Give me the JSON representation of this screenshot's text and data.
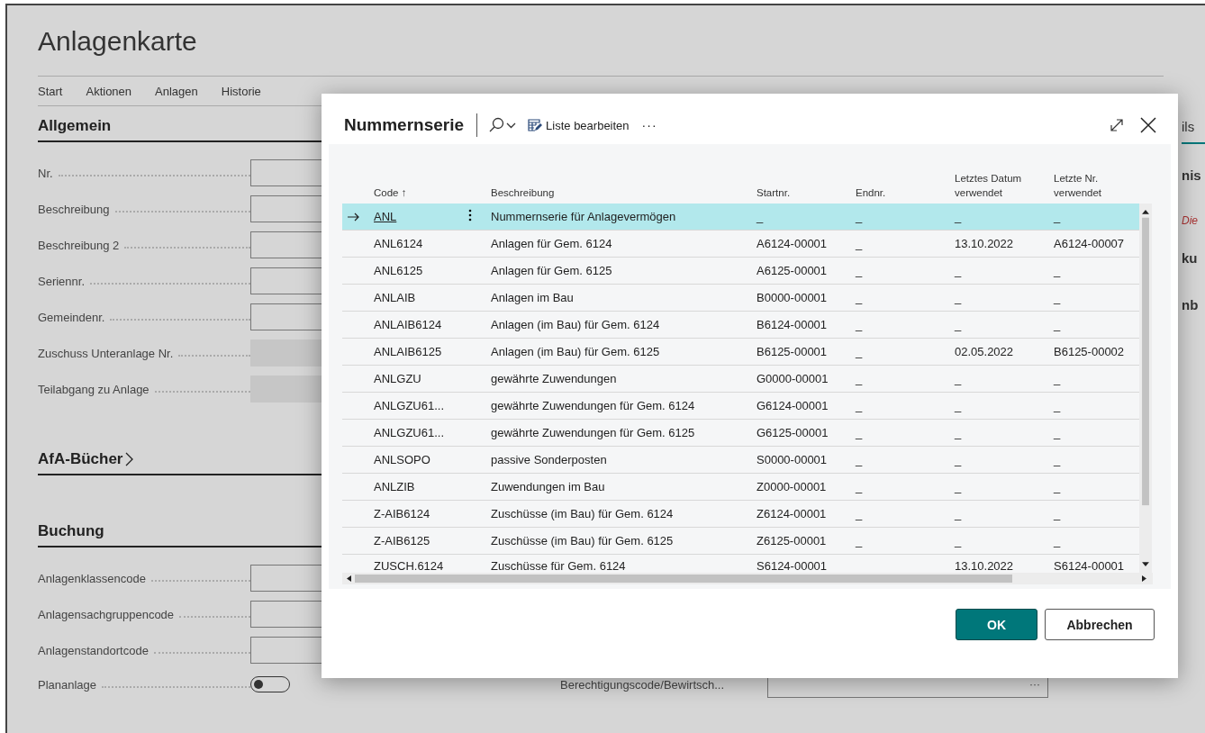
{
  "page": {
    "title": "Anlagenkarte",
    "tabs": [
      {
        "label": "Start"
      },
      {
        "label": "Aktionen"
      },
      {
        "label": "Anlagen"
      },
      {
        "label": "Historie"
      }
    ],
    "sections": [
      {
        "title": "Allgemein",
        "kind": "fields",
        "fields": [
          {
            "label": "Nr.",
            "disabled": false
          },
          {
            "label": "Beschreibung",
            "disabled": false
          },
          {
            "label": "Beschreibung 2",
            "disabled": false
          },
          {
            "label": "Seriennr.",
            "disabled": false
          },
          {
            "label": "Gemeindenr.",
            "disabled": false
          },
          {
            "label": "Zuschuss Unteranlage Nr.",
            "disabled": true
          },
          {
            "label": "Teilabgang zu Anlage",
            "disabled": true
          }
        ]
      },
      {
        "title": "AfA-Bücher",
        "kind": "collapsed"
      },
      {
        "title": "Buchung",
        "kind": "fields",
        "fields": [
          {
            "label": "Anlagenklassencode",
            "disabled": false
          },
          {
            "label": "Anlagensachgruppencode",
            "disabled": false
          },
          {
            "label": "Anlagenstandortcode",
            "disabled": false
          }
        ]
      }
    ],
    "toggle": {
      "label": "Plananlage",
      "on": false
    },
    "lookup_field": {
      "label": "Berechtigungscode/Bewirtsch...",
      "button": "···"
    },
    "side_fragments": [
      {
        "text": "ils",
        "kind": "tab"
      },
      {
        "text": "nis",
        "kind": "heading"
      },
      {
        "text": "Die",
        "kind": "note"
      },
      {
        "text": "ku",
        "kind": "heading"
      },
      {
        "text": "nb",
        "kind": "heading"
      }
    ]
  },
  "dialog": {
    "title": "Nummernserie",
    "edit_list": "Liste bearbeiten",
    "more": "···",
    "columns": [
      "Code ↑",
      "Beschreibung",
      "Startnr.",
      "Endnr.",
      "Letztes Datum verwendet",
      "Letzte Nr. verwendet"
    ],
    "rows": [
      {
        "code": "ANL",
        "description": "Nummernserie für Anlagevermögen",
        "start_no": "_",
        "end_no": "_",
        "last_date": "_",
        "last_no": "_",
        "selected": true
      },
      {
        "code": "ANL6124",
        "description": "Anlagen für Gem. 6124",
        "start_no": "A6124-00001",
        "end_no": "_",
        "last_date": "13.10.2022",
        "last_no": "A6124-00007",
        "selected": false
      },
      {
        "code": "ANL6125",
        "description": "Anlagen für Gem. 6125",
        "start_no": "A6125-00001",
        "end_no": "_",
        "last_date": "_",
        "last_no": "_",
        "selected": false
      },
      {
        "code": "ANLAIB",
        "description": "Anlagen im Bau",
        "start_no": "B0000-00001",
        "end_no": "_",
        "last_date": "_",
        "last_no": "_",
        "selected": false
      },
      {
        "code": "ANLAIB6124",
        "description": "Anlagen (im Bau) für Gem. 6124",
        "start_no": "B6124-00001",
        "end_no": "_",
        "last_date": "_",
        "last_no": "_",
        "selected": false
      },
      {
        "code": "ANLAIB6125",
        "description": "Anlagen (im Bau) für Gem. 6125",
        "start_no": "B6125-00001",
        "end_no": "_",
        "last_date": "02.05.2022",
        "last_no": "B6125-00002",
        "selected": false
      },
      {
        "code": "ANLGZU",
        "description": "gewährte Zuwendungen",
        "start_no": "G0000-00001",
        "end_no": "_",
        "last_date": "_",
        "last_no": "_",
        "selected": false
      },
      {
        "code": "ANLGZU61...",
        "description": "gewährte Zuwendungen für Gem. 6124",
        "start_no": "G6124-00001",
        "end_no": "_",
        "last_date": "_",
        "last_no": "_",
        "selected": false
      },
      {
        "code": "ANLGZU61...",
        "description": "gewährte Zuwendungen für Gem. 6125",
        "start_no": "G6125-00001",
        "end_no": "_",
        "last_date": "_",
        "last_no": "_",
        "selected": false
      },
      {
        "code": "ANLSOPO",
        "description": "passive Sonderposten",
        "start_no": "S0000-00001",
        "end_no": "_",
        "last_date": "_",
        "last_no": "_",
        "selected": false
      },
      {
        "code": "ANLZIB",
        "description": "Zuwendungen im Bau",
        "start_no": "Z0000-00001",
        "end_no": "_",
        "last_date": "_",
        "last_no": "_",
        "selected": false
      },
      {
        "code": "Z-AIB6124",
        "description": "Zuschüsse (im Bau) für Gem. 6124",
        "start_no": "Z6124-00001",
        "end_no": "_",
        "last_date": "_",
        "last_no": "_",
        "selected": false
      },
      {
        "code": "Z-AIB6125",
        "description": "Zuschüsse (im Bau) für Gem. 6125",
        "start_no": "Z6125-00001",
        "end_no": "_",
        "last_date": "_",
        "last_no": "_",
        "selected": false
      },
      {
        "code": "ZUSCH.6124",
        "description": "Zuschüsse für Gem. 6124",
        "start_no": "S6124-00001",
        "last_date": "13.10.2022",
        "last_no": "S6124-00001",
        "selected": false
      }
    ],
    "buttons": [
      {
        "label": "OK",
        "kind": "primary"
      },
      {
        "label": "Abbrechen",
        "kind": "secondary"
      }
    ]
  }
}
